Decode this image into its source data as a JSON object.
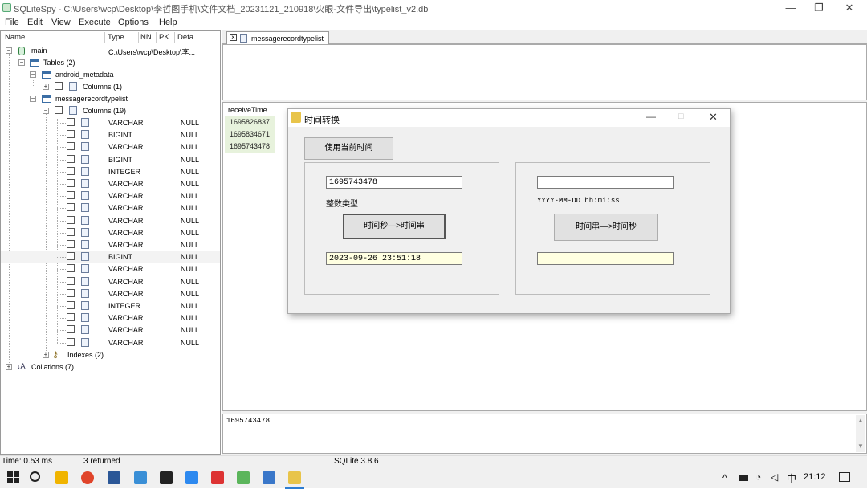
{
  "window": {
    "title": "SQLiteSpy - C:\\Users\\wcp\\Desktop\\李哲图手机\\文件文档_20231121_210918\\火眼-文件导出\\typelist_v2.db",
    "min": "—",
    "max": "❐",
    "close": "✕"
  },
  "menu": [
    "File",
    "Edit",
    "View",
    "Execute",
    "Options",
    "Help"
  ],
  "schema": {
    "headers": [
      "Name",
      "Type",
      "NN",
      "PK",
      "Defa..."
    ],
    "main": {
      "label": "main",
      "path": "C:\\Users\\wcp\\Desktop\\李..."
    },
    "tables": "Tables (2)",
    "android_metadata": "android_metadata",
    "columns1": "Columns (1)",
    "messagerecord": "messagerecordtypelist",
    "columns19": "Columns (19)",
    "columns": [
      {
        "type": "VARCHAR",
        "def": "NULL"
      },
      {
        "type": "BIGINT",
        "def": "NULL"
      },
      {
        "type": "VARCHAR",
        "def": "NULL"
      },
      {
        "type": "BIGINT",
        "def": "NULL"
      },
      {
        "type": "INTEGER",
        "def": "NULL"
      },
      {
        "type": "VARCHAR",
        "def": "NULL"
      },
      {
        "type": "VARCHAR",
        "def": "NULL"
      },
      {
        "type": "VARCHAR",
        "def": "NULL"
      },
      {
        "type": "VARCHAR",
        "def": "NULL"
      },
      {
        "type": "VARCHAR",
        "def": "NULL"
      },
      {
        "type": "VARCHAR",
        "def": "NULL"
      },
      {
        "type": "BIGINT",
        "def": "NULL"
      },
      {
        "type": "VARCHAR",
        "def": "NULL"
      },
      {
        "type": "VARCHAR",
        "def": "NULL"
      },
      {
        "type": "VARCHAR",
        "def": "NULL"
      },
      {
        "type": "INTEGER",
        "def": "NULL"
      },
      {
        "type": "VARCHAR",
        "def": "NULL"
      },
      {
        "type": "VARCHAR",
        "def": "NULL"
      },
      {
        "type": "VARCHAR",
        "def": "NULL"
      }
    ],
    "indexes": "Indexes (2)",
    "collations": "Collations (7)"
  },
  "tab": {
    "label": "messagerecordtypelist"
  },
  "grid": {
    "header": "receiveTime",
    "rows": [
      "1695826837",
      "1695834671",
      "1695743478"
    ]
  },
  "bottom_text": "1695743478",
  "status": {
    "time": "Time: 0.53 ms",
    "returned": "3 returned",
    "version": "SQLite 3.8.6"
  },
  "dialog": {
    "title": "时间转换",
    "use_now": "使用当前时间",
    "int_input": "1695743478",
    "int_label": "整数类型",
    "to_string_btn": "时间秒—>时间串",
    "result_string": "2023-09-26 23:51:18",
    "str_input": "",
    "format_label": "YYYY-MM-DD hh:mi:ss",
    "to_seconds_btn": "时间串—>时间秒",
    "result_seconds": ""
  },
  "taskbar": {
    "tray_caret": "^",
    "ime": "中",
    "time": "21:12"
  }
}
